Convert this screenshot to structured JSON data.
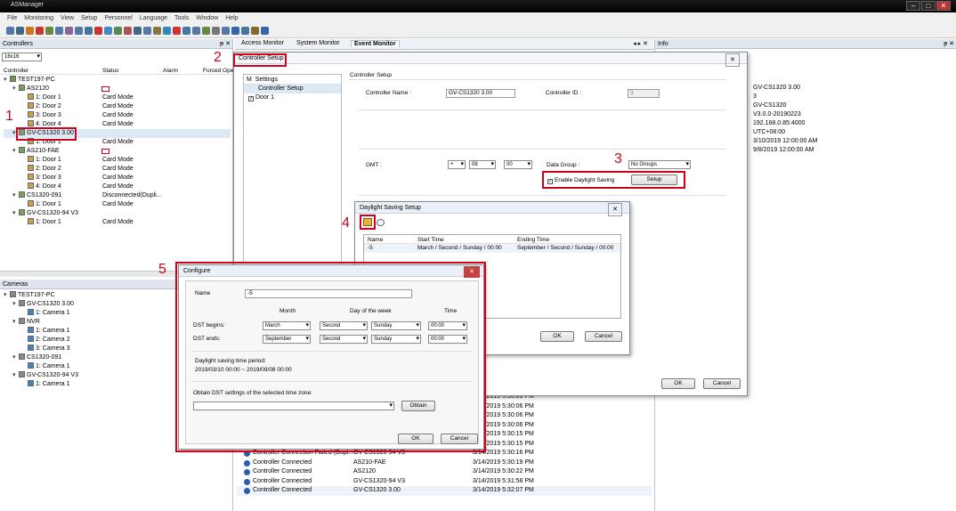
{
  "window": {
    "title": "ASManager"
  },
  "menu": [
    "File",
    "Monitoring",
    "View",
    "Setup",
    "Personnel",
    "Language",
    "Tools",
    "Window",
    "Help"
  ],
  "controllers": {
    "title": "Controllers",
    "pin": "ᵽ",
    "close": "✕",
    "combo": "16x16",
    "columns": [
      "Controller",
      "Status",
      "Alarm",
      "Forced Ope"
    ],
    "rows": [
      {
        "indent": 0,
        "tri": "▾",
        "icon": "pc",
        "name": "TEST197-PC",
        "status": ""
      },
      {
        "indent": 1,
        "tri": "▾",
        "icon": "ctrl",
        "name": "AS2120",
        "status": "",
        "flag": true
      },
      {
        "indent": 2,
        "tri": "",
        "icon": "door",
        "name": "1: Door 1",
        "status": "Card Mode"
      },
      {
        "indent": 2,
        "tri": "",
        "icon": "door",
        "name": "2: Door 2",
        "status": "Card Mode"
      },
      {
        "indent": 2,
        "tri": "",
        "icon": "door",
        "name": "3: Door 3",
        "status": "Card Mode"
      },
      {
        "indent": 2,
        "tri": "",
        "icon": "door",
        "name": "4: Door 4",
        "status": "Card Mode"
      },
      {
        "indent": 1,
        "tri": "▾",
        "icon": "ctrl",
        "name": "GV-CS1320 3.00",
        "status": "",
        "selected": true
      },
      {
        "indent": 2,
        "tri": "",
        "icon": "door",
        "name": "1: Door 1",
        "status": "Card Mode"
      },
      {
        "indent": 1,
        "tri": "▾",
        "icon": "ctrl",
        "name": "AS210-FAE",
        "status": "",
        "flag": true
      },
      {
        "indent": 2,
        "tri": "",
        "icon": "door",
        "name": "1: Door 1",
        "status": "Card Mode"
      },
      {
        "indent": 2,
        "tri": "",
        "icon": "door",
        "name": "2: Door 2",
        "status": "Card Mode"
      },
      {
        "indent": 2,
        "tri": "",
        "icon": "door",
        "name": "3: Door 3",
        "status": "Card Mode"
      },
      {
        "indent": 2,
        "tri": "",
        "icon": "door",
        "name": "4: Door 4",
        "status": "Card Mode"
      },
      {
        "indent": 1,
        "tri": "▾",
        "icon": "ctrl",
        "name": "CS1320-091",
        "status": "Disconnected(Dupli..."
      },
      {
        "indent": 2,
        "tri": "",
        "icon": "door",
        "name": "1: Door 1",
        "status": "Card Mode"
      },
      {
        "indent": 1,
        "tri": "▾",
        "icon": "ctrl",
        "name": "GV-CS1320-94 V3",
        "status": ""
      },
      {
        "indent": 2,
        "tri": "",
        "icon": "door",
        "name": "1: Door 1",
        "status": "Card Mode"
      }
    ]
  },
  "cameras": {
    "title": "Cameras",
    "rows": [
      {
        "indent": 0,
        "tri": "▾",
        "name": "TEST197-PC"
      },
      {
        "indent": 1,
        "tri": "▾",
        "name": "GV-CS1320 3.00"
      },
      {
        "indent": 2,
        "tri": "",
        "name": "1: Camera 1"
      },
      {
        "indent": 1,
        "tri": "▾",
        "name": "NVR"
      },
      {
        "indent": 2,
        "tri": "",
        "name": "1: Camera 1"
      },
      {
        "indent": 2,
        "tri": "",
        "name": "2: Camera 2"
      },
      {
        "indent": 2,
        "tri": "",
        "name": "3: Camera 3"
      },
      {
        "indent": 1,
        "tri": "▾",
        "name": "CS1320-091"
      },
      {
        "indent": 2,
        "tri": "",
        "name": "1: Camera 1"
      },
      {
        "indent": 1,
        "tri": "▾",
        "name": "GV-CS1320-94 V3"
      },
      {
        "indent": 2,
        "tri": "",
        "name": "1: Camera 1"
      }
    ]
  },
  "tabs": [
    "Access Monitor",
    "System Monitor",
    "Event Monitor"
  ],
  "tabnav": "◂ ▸ ✕",
  "events": [
    {
      "msg": "",
      "src": "",
      "time": "3/14/2019 5:30:06 PM"
    },
    {
      "msg": "",
      "src": "",
      "time": "3/14/2019 5:30:06 PM"
    },
    {
      "msg": "",
      "src": "",
      "time": "3/14/2019 5:30:06 PM"
    },
    {
      "msg": "",
      "src": "",
      "time": "3/14/2019 5:30:06 PM"
    },
    {
      "msg": "",
      "src": "",
      "time": "3/14/2019 5:30:15 PM"
    },
    {
      "msg": "",
      "src": "",
      "time": "3/14/2019 5:30:15 PM"
    },
    {
      "msg": "Controller Connection Failed (Dupl...",
      "src": "GV-CS1320-94 V3",
      "time": "3/14/2019 5:30:16 PM"
    },
    {
      "msg": "Controller Connected",
      "src": "AS210-FAE",
      "time": "3/14/2019 5:30:19 PM"
    },
    {
      "msg": "Controller Connected",
      "src": "AS2120",
      "time": "3/14/2019 5:30:22 PM"
    },
    {
      "msg": "Controller Connected",
      "src": "GV-CS1320-94 V3",
      "time": "3/14/2019 5:31:58 PM"
    },
    {
      "msg": "Controller Connected",
      "src": "GV-CS1320 3.00",
      "time": "3/14/2019 5:32:07 PM"
    }
  ],
  "info": {
    "title": "Info",
    "lines": [
      "GV-CS1320 3.00",
      "3",
      "GV-CS1320",
      "V3.0.0-20190223",
      "192.168.0.85:4000",
      "UTC+08:00",
      "3/10/2019 12:00:00 AM",
      "9/8/2019 12:00:00 AM"
    ]
  },
  "ctrlsetup": {
    "tab": "Controller Setup",
    "close": "✕",
    "tree_header": "Settings",
    "tree_m": "M",
    "tree": [
      "Controller Setup",
      "Door 1"
    ],
    "section": "Controller Setup",
    "name_label": "Controller Name :",
    "name_value": "GV-CS1320 3.00",
    "id_label": "Controller ID :",
    "id_value": "3",
    "gmt_label": "GMT :",
    "gmt_sign": "+",
    "gmt_hour": "08",
    "gmt_min": "00",
    "group_label": "Data Group :",
    "group_value": "No Groups",
    "dst_label": "Enable Daylight Saving",
    "setup_btn": "Setup",
    "ok": "OK",
    "cancel": "Cancel"
  },
  "dst": {
    "title": "Daylight Saving Setup",
    "close": "✕",
    "cols": [
      "Name",
      "Start Time",
      "Ending Time"
    ],
    "row": {
      "name": "-5",
      "start": "March / Second / Sunday / 00:00",
      "end": "September / Second / Sunday / 00:00"
    },
    "ok": "OK",
    "cancel": "Cancel"
  },
  "configure": {
    "title": "Configure",
    "close": "✕",
    "name_label": "Name",
    "name_value": "-5",
    "col_month": "Month",
    "col_dow": "Day of the week",
    "col_time": "Time",
    "begins_label": "DST begins:",
    "ends_label": "DST ends:",
    "begins": {
      "month": "March",
      "week": "Second",
      "day": "Sunday",
      "time": "00:00"
    },
    "ends": {
      "month": "September",
      "week": "Second",
      "day": "Sunday",
      "time": "00:00"
    },
    "period_label": "Daylight saving time period:",
    "period_value": "2019/03/10  00:00  ~  2019/09/08  00:00",
    "obtain_label": "Obtain DST settings of the selected time zone:",
    "obtain_btn": "Obtain",
    "ok": "OK",
    "cancel": "Cancel"
  },
  "markers": [
    "1",
    "2",
    "3",
    "4",
    "5"
  ],
  "colors": {
    "highlight": "#d0021b"
  }
}
